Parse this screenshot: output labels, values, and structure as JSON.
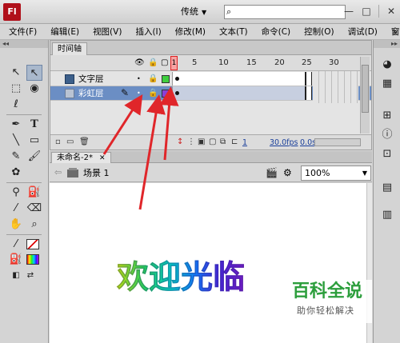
{
  "app": {
    "logo": "Fl",
    "workspace": "传统",
    "search_placeholder": ""
  },
  "menu": [
    "文件(F)",
    "编辑(E)",
    "视图(V)",
    "插入(I)",
    "修改(M)",
    "文本(T)",
    "命令(C)",
    "控制(O)",
    "调试(D)",
    "窗口(W)"
  ],
  "menu_more": "»",
  "timeline": {
    "tab_label": "时间轴",
    "frame_numbers": [
      "1",
      "5",
      "10",
      "15",
      "20",
      "25",
      "30"
    ],
    "layers": [
      {
        "name": "文字层",
        "color": "#3fcf3f",
        "selected": false
      },
      {
        "name": "彩虹层",
        "color": "#8a3fd6",
        "selected": true
      }
    ],
    "footer": {
      "current_frame": "1",
      "fps": "30.0fps",
      "time": "0.0s"
    }
  },
  "document": {
    "tab_label": "未命名-2*",
    "scene_label": "场景 1",
    "zoom": "100%"
  },
  "stage": {
    "banner_text": "欢迎光临"
  },
  "watermark": {
    "title": "百科全说",
    "subtitle": "助你轻松解决"
  },
  "colors": {
    "annotation_arrow": "#e0262a",
    "selected_layer": "#6b8ec4"
  }
}
